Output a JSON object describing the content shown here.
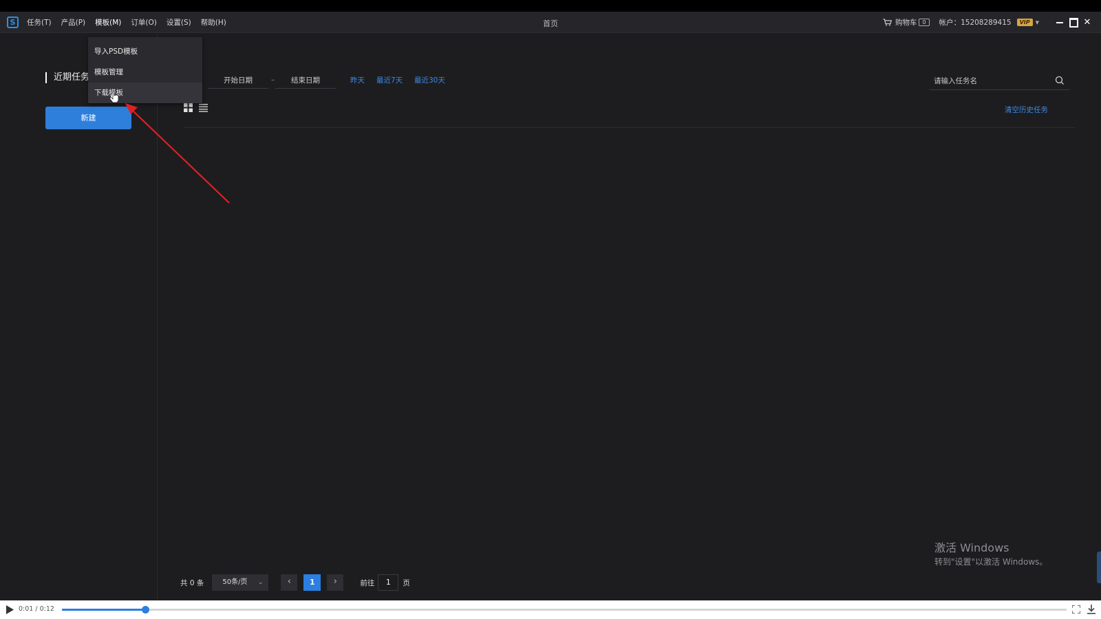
{
  "app": {
    "logo_letter": "S",
    "menus": [
      "任务(T)",
      "产品(P)",
      "模板(M)",
      "订单(O)",
      "设置(S)",
      "帮助(H)"
    ],
    "window_title": "首页",
    "cart_label": "购物车",
    "cart_count": "0",
    "account_label": "帐户：15208289415",
    "vip_badge": "VIP"
  },
  "dropdown": {
    "items": [
      "导入PSD模板",
      "模板管理",
      "下载模板"
    ],
    "hovered_index": 2
  },
  "sidebar": {
    "recent_label": "近期任务",
    "new_button": "新建"
  },
  "filters": {
    "start_date": "开始日期",
    "separator": "–",
    "end_date": "结束日期",
    "quick": [
      "昨天",
      "最近7天",
      "最近30天"
    ],
    "search_placeholder": "请输入任务名",
    "clear_history": "清空历史任务"
  },
  "pager": {
    "total": "共 0 条",
    "per_page": "50条/页",
    "current_page": "1",
    "goto_label": "前往",
    "goto_value": "1",
    "page_suffix": "页"
  },
  "watermark": {
    "title": "激活 Windows",
    "subtitle": "转到\"设置\"以激活 Windows。"
  },
  "player": {
    "time": "0:01 / 0:12",
    "progress": 0.083
  },
  "colors": {
    "accent": "#2e7fdb",
    "link": "#3d8ae6",
    "background": "#1d1d20",
    "annotation_arrow": "#e02020"
  }
}
